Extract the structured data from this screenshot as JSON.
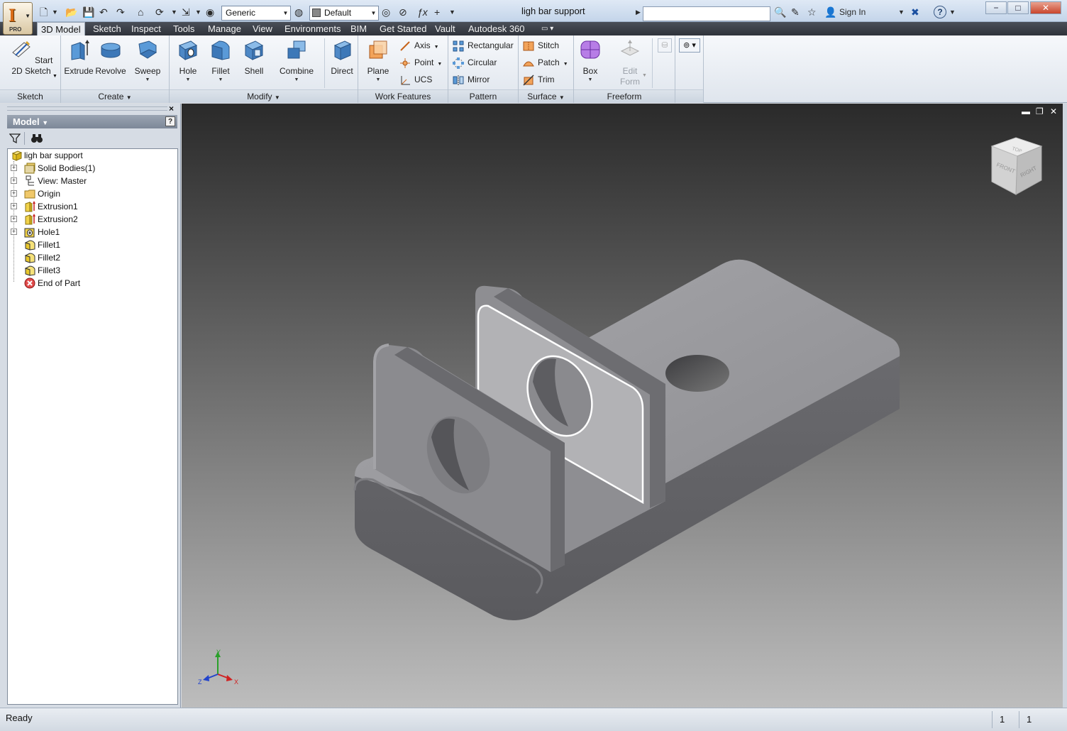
{
  "window": {
    "title": "ligh bar support",
    "app_letter": "I",
    "app_edition": "PRO",
    "minimize": "−",
    "maximize": "□",
    "close": "✕"
  },
  "quick_access": {
    "material": "Generic",
    "appearance": "Default",
    "fx": "ƒx",
    "search_placeholder": "",
    "sign_in": "Sign In",
    "help": "?"
  },
  "tabs": [
    "3D Model",
    "Sketch",
    "Inspect",
    "Tools",
    "Manage",
    "View",
    "Environments",
    "BIM",
    "Get Started",
    "Vault",
    "Autodesk 360"
  ],
  "ribbon": {
    "sketch_panel": {
      "label": "Sketch",
      "start_sketch": "Start 2D Sketch"
    },
    "create_panel": {
      "label": "Create",
      "extrude": "Extrude",
      "revolve": "Revolve",
      "sweep": "Sweep"
    },
    "modify_panel": {
      "label": "Modify",
      "hole": "Hole",
      "fillet": "Fillet",
      "shell": "Shell",
      "combine": "Combine",
      "direct": "Direct"
    },
    "work_features_panel": {
      "label": "Work Features",
      "plane": "Plane",
      "axis": "Axis",
      "point": "Point",
      "ucs": "UCS"
    },
    "pattern_panel": {
      "label": "Pattern",
      "rectangular": "Rectangular",
      "circular": "Circular",
      "mirror": "Mirror"
    },
    "surface_panel": {
      "label": "Surface",
      "stitch": "Stitch",
      "patch": "Patch",
      "trim": "Trim"
    },
    "freeform_panel": {
      "label": "Freeform",
      "box": "Box",
      "edit_form": "Edit Form"
    }
  },
  "browser": {
    "title": "Model",
    "help": "?",
    "close": "×",
    "tree": [
      {
        "label": "ligh bar support",
        "icon": "part-icon",
        "expandable": false
      },
      {
        "label": "Solid Bodies(1)",
        "icon": "solid-bodies-icon",
        "expandable": true
      },
      {
        "label": "View: Master",
        "icon": "view-rep-icon",
        "expandable": true
      },
      {
        "label": "Origin",
        "icon": "folder-icon",
        "expandable": true
      },
      {
        "label": "Extrusion1",
        "icon": "extrusion-icon",
        "expandable": true
      },
      {
        "label": "Extrusion2",
        "icon": "extrusion-icon",
        "expandable": true
      },
      {
        "label": "Hole1",
        "icon": "hole-icon",
        "expandable": true
      },
      {
        "label": "Fillet1",
        "icon": "fillet-icon",
        "expandable": false
      },
      {
        "label": "Fillet2",
        "icon": "fillet-icon",
        "expandable": false
      },
      {
        "label": "Fillet3",
        "icon": "fillet-icon",
        "expandable": false
      },
      {
        "label": "End of Part",
        "icon": "end-of-part-icon",
        "expandable": false
      }
    ]
  },
  "viewcube": {
    "top": "TOP",
    "front": "FRONT",
    "right": "RIGHT"
  },
  "axis_triad": {
    "x": "X",
    "y": "Y",
    "z": "Z"
  },
  "viewport_controls": {
    "minimize": "▬",
    "restore": "❐",
    "close": "✕"
  },
  "status": {
    "text": "Ready",
    "cell1": "1",
    "cell2": "1"
  },
  "colors": {
    "ribbon_tab_bar": "#3a3e45",
    "viewport_top": "#2a2a2a",
    "viewport_bottom": "#bdbdbd",
    "model_gray": "#8f8f93",
    "app_orange": "#d86a15"
  }
}
